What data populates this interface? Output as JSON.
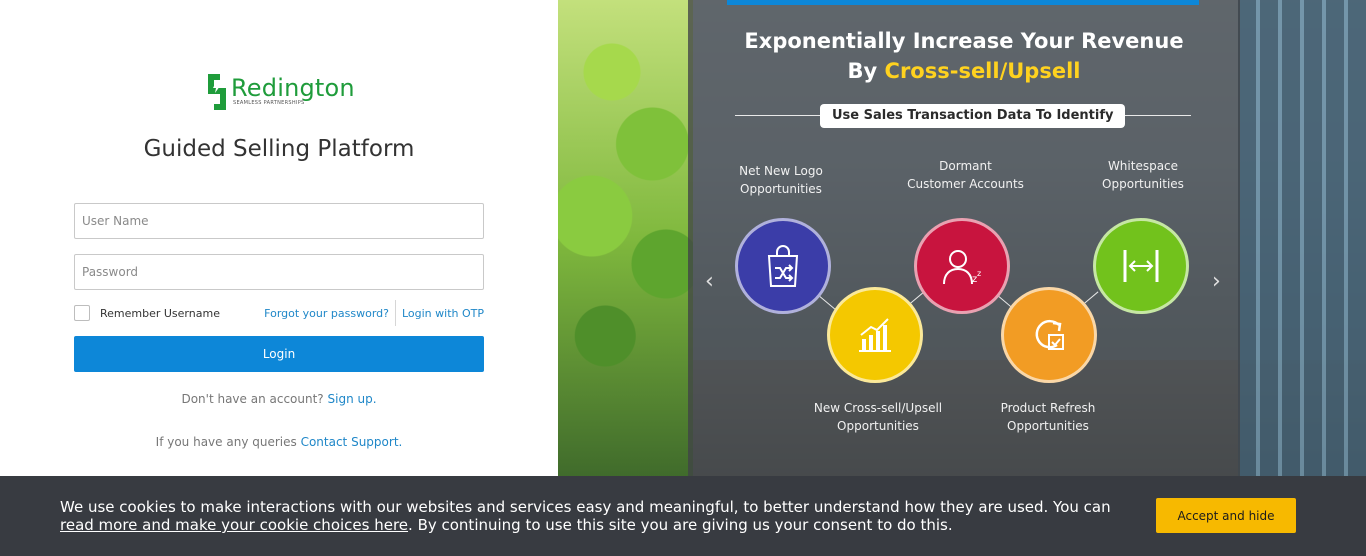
{
  "login": {
    "brand_name": "Redington",
    "brand_tagline": "SEAMLESS PARTNERSHIPS",
    "app_title": "Guided Selling Platform",
    "username_placeholder": "User Name",
    "password_placeholder": "Password",
    "remember_label": "Remember Username",
    "remember_checked": false,
    "forgot_link": "Forgot your password?",
    "otp_link": "Login with OTP",
    "login_button": "Login",
    "signup_prefix": "Don't have an account?",
    "signup_link": "Sign up.",
    "support_prefix": "If you have any queries",
    "support_link": "Contact Support."
  },
  "promo": {
    "title_line1": "Exponentially Increase Your Revenue",
    "title_line2_prefix": "By",
    "title_line2_highlight": "Cross-sell/Upsell",
    "subtitle": "Use Sales Transaction Data To Identify",
    "items": [
      {
        "line1": "Net New Logo",
        "line2": "Opportunities",
        "icon": "shopping-bag-shuffle-icon",
        "color": "#3b3da8"
      },
      {
        "line1": "Dormant",
        "line2": "Customer Accounts",
        "icon": "sleeping-user-icon",
        "color": "#c8143e"
      },
      {
        "line1": "Whitespace",
        "line2": "Opportunities",
        "icon": "expand-width-icon",
        "color": "#72c21c"
      },
      {
        "line1": "New Cross-sell/Upsell",
        "line2": "Opportunities",
        "icon": "bar-chart-growth-icon",
        "color": "#f4c800"
      },
      {
        "line1": "Product Refresh",
        "line2": "Opportunities",
        "icon": "refresh-check-icon",
        "color": "#f29c24"
      }
    ],
    "accent_color": "#ffd21f"
  },
  "cookie": {
    "text_prefix": "We use cookies to make interactions with our websites and services easy and meaningful, to better understand how they are used. You can",
    "link_text": "read more and make your cookie choices here",
    "text_suffix": ". By continuing to use this site you are giving us your consent to do this.",
    "accept_button": "Accept and hide"
  },
  "colors": {
    "primary": "#0d87d8",
    "brand_green": "#1f9c3b",
    "cookie_bg": "#383b41",
    "accept_bg": "#f7b900"
  }
}
